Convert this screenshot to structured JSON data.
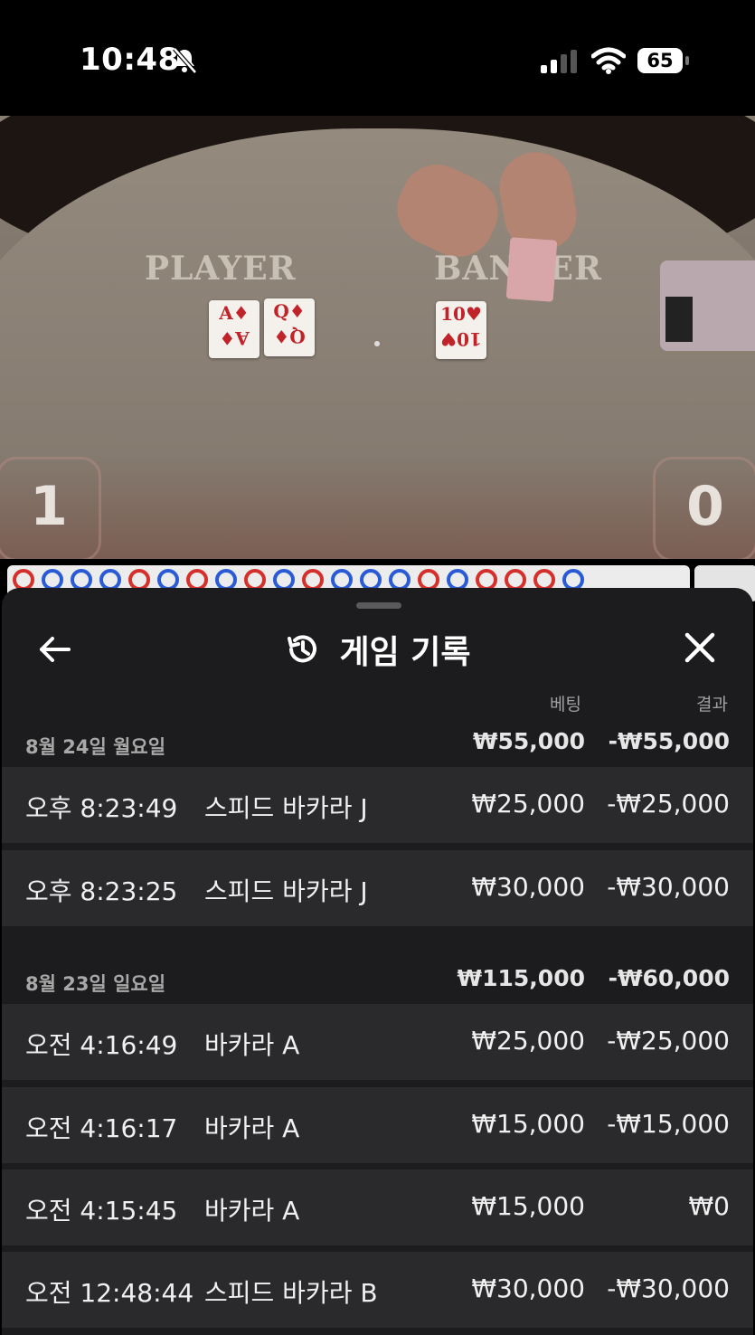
{
  "status_bar": {
    "time": "10:48",
    "battery": "65"
  },
  "video": {
    "player_label": "PLAYER",
    "banker_label": "BANKER",
    "player_cards": [
      {
        "rank": "A",
        "suit": "♦"
      },
      {
        "rank": "Q",
        "suit": "♦"
      }
    ],
    "banker_cards": [
      {
        "rank": "10",
        "suit": "♥"
      }
    ],
    "player_score": "1",
    "banker_score": "0"
  },
  "sheet": {
    "title": "게임 기록",
    "columns": {
      "bet": "베팅",
      "result": "결과"
    },
    "groups": [
      {
        "date": "8월 24일 월요일",
        "bet_total": "₩55,000",
        "result_total": "-₩55,000",
        "rows": [
          {
            "time": "오후 8:23:49",
            "game": "스피드 바카라 J",
            "bet": "₩25,000",
            "result": "-₩25,000"
          },
          {
            "time": "오후 8:23:25",
            "game": "스피드 바카라 J",
            "bet": "₩30,000",
            "result": "-₩30,000"
          }
        ]
      },
      {
        "date": "8월 23일 일요일",
        "bet_total": "₩115,000",
        "result_total": "-₩60,000",
        "rows": [
          {
            "time": "오전 4:16:49",
            "game": "바카라 A",
            "bet": "₩25,000",
            "result": "-₩25,000"
          },
          {
            "time": "오전 4:16:17",
            "game": "바카라 A",
            "bet": "₩15,000",
            "result": "-₩15,000"
          },
          {
            "time": "오전 4:15:45",
            "game": "바카라 A",
            "bet": "₩15,000",
            "result": "₩0"
          },
          {
            "time": "오전 12:48:44",
            "game": "스피드 바카라 B",
            "bet": "₩30,000",
            "result": "-₩30,000"
          }
        ]
      }
    ]
  },
  "colors": {
    "sheet_bg": "#1c1c1e",
    "row_bg": "#2a2a2c",
    "player_blue": "#2a5bd7",
    "banker_red": "#d6302c"
  }
}
